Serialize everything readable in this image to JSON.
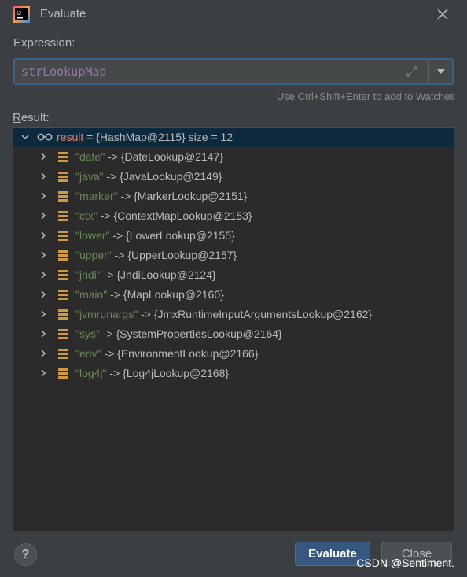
{
  "window": {
    "title": "Evaluate",
    "logo_text": "IJ"
  },
  "expression": {
    "label": "Expression:",
    "value": "strLookupMap",
    "hint": "Use Ctrl+Shift+Enter to add to Watches"
  },
  "result": {
    "label_first": "R",
    "label_rest": "esult:",
    "root": {
      "name": "result",
      "eq": " = ",
      "value": "{HashMap@2115}",
      "extra": "  size = 12"
    },
    "entries": [
      {
        "key": "\"date\"",
        "arrow": " -> ",
        "value": "{DateLookup@2147}"
      },
      {
        "key": "\"java\"",
        "arrow": " -> ",
        "value": "{JavaLookup@2149}"
      },
      {
        "key": "\"marker\"",
        "arrow": " -> ",
        "value": "{MarkerLookup@2151}"
      },
      {
        "key": "\"ctx\"",
        "arrow": " -> ",
        "value": "{ContextMapLookup@2153}"
      },
      {
        "key": "\"lower\"",
        "arrow": " -> ",
        "value": "{LowerLookup@2155}"
      },
      {
        "key": "\"upper\"",
        "arrow": " -> ",
        "value": "{UpperLookup@2157}"
      },
      {
        "key": "\"jndi\"",
        "arrow": " -> ",
        "value": "{JndiLookup@2124}"
      },
      {
        "key": "\"main\"",
        "arrow": " -> ",
        "value": "{MapLookup@2160}"
      },
      {
        "key": "\"jvmrunargs\"",
        "arrow": " -> ",
        "value": "{JmxRuntimeInputArgumentsLookup@2162}"
      },
      {
        "key": "\"sys\"",
        "arrow": " -> ",
        "value": "{SystemPropertiesLookup@2164}"
      },
      {
        "key": "\"env\"",
        "arrow": " -> ",
        "value": "{EnvironmentLookup@2166}"
      },
      {
        "key": "\"log4j\"",
        "arrow": " -> ",
        "value": "{Log4jLookup@2168}"
      }
    ]
  },
  "buttons": {
    "help": "?",
    "evaluate": "Evaluate",
    "close": "Close"
  },
  "watermark": "CSDN @Sentiment.",
  "icons": {
    "logo": "intellij-logo-icon",
    "close": "close-icon",
    "expand": "expand-icon",
    "dropdown": "chevron-down-icon",
    "watch": "glasses-icon",
    "field": "field-icon"
  },
  "colors": {
    "background": "#3c3f41",
    "tree_background": "#2b2b2b",
    "selection": "#0d293e",
    "expression_text": "#9876aa",
    "string_key": "#6a8759",
    "variable_name": "#e6816f",
    "field_icon": "#d19a3c",
    "primary_button": "#365880"
  }
}
